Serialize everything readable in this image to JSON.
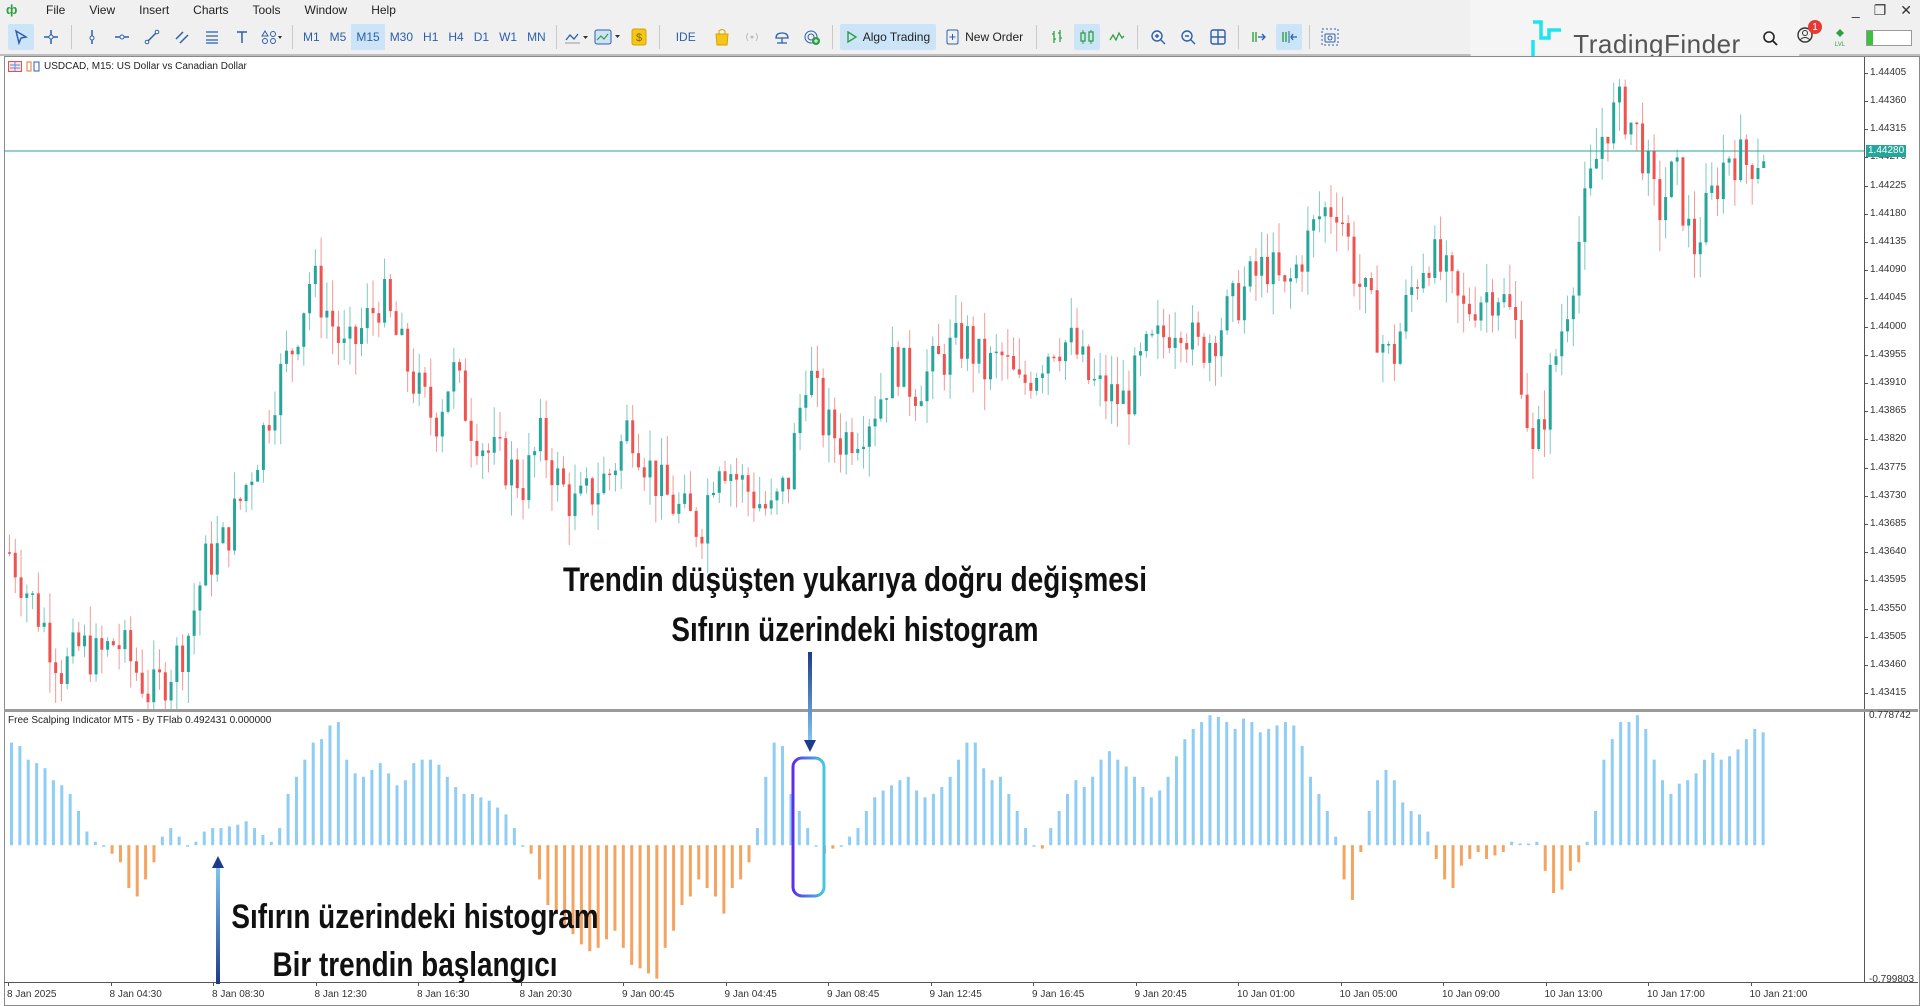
{
  "app": {
    "menu": [
      "File",
      "View",
      "Insert",
      "Charts",
      "Tools",
      "Window",
      "Help"
    ],
    "window_controls": [
      "minimize",
      "restore",
      "close"
    ]
  },
  "toolbar": {
    "draw_tools": [
      {
        "name": "cursor-icon",
        "active": true
      },
      {
        "name": "crosshair-icon",
        "active": false
      },
      {
        "name": "vertical-line-icon",
        "active": false
      },
      {
        "name": "horizontal-line-icon",
        "active": false
      },
      {
        "name": "trendline-icon",
        "active": false
      },
      {
        "name": "channel-icon",
        "active": false
      },
      {
        "name": "fibonacci-icon",
        "active": false
      },
      {
        "name": "text-icon",
        "active": false
      },
      {
        "name": "shapes-icon",
        "active": false
      }
    ],
    "timeframes": [
      "M1",
      "M5",
      "M15",
      "M30",
      "H1",
      "H4",
      "D1",
      "W1",
      "MN"
    ],
    "active_timeframe": "M15",
    "ide_label": "IDE",
    "algo_trading_label": "Algo Trading",
    "new_order_label": "New Order",
    "notification_count": "1"
  },
  "watermark": {
    "text": "TradingFinder"
  },
  "chart": {
    "title": "USDCAD, M15:  US Dollar vs Canadian Dollar",
    "last_price": "1.44280",
    "colors": {
      "bull": "#26a69a",
      "bear": "#ef5350",
      "hist_pos": "#8ecdf5",
      "hist_neg": "#f4a460",
      "price_line": "#26a69a"
    }
  },
  "indicator": {
    "title": "Free Scalping Indicator MT5 - By TFlab 0.492431 0.000000",
    "max_label": "0.778742",
    "min_label": "-0.799803"
  },
  "annotations": {
    "top_line1": "Trendin düşüşten yukarıya doğru değişmesi",
    "top_line2": "Sıfırın üzerindeki histogram",
    "bottom_line1": "Sıfırın üzerindeki histogram",
    "bottom_line2": "Bir trendin başlangıcı"
  },
  "chart_data": {
    "type": "candlestick",
    "title": "USDCAD, M15",
    "price_ticks": [
      "1.44405",
      "1.44360",
      "1.44315",
      "1.44270",
      "1.44225",
      "1.44180",
      "1.44135",
      "1.44090",
      "1.44045",
      "1.44000",
      "1.43955",
      "1.43910",
      "1.43865",
      "1.43820",
      "1.43775",
      "1.43730",
      "1.43685",
      "1.43640",
      "1.43595",
      "1.43550",
      "1.43505",
      "1.43460",
      "1.43415"
    ],
    "price_range": [
      1.4339,
      1.4443
    ],
    "time_ticks": [
      "8 Jan 2025",
      "8 Jan 04:30",
      "8 Jan 08:30",
      "8 Jan 12:30",
      "8 Jan 16:30",
      "8 Jan 20:30",
      "9 Jan 00:45",
      "9 Jan 04:45",
      "9 Jan 08:45",
      "9 Jan 12:45",
      "9 Jan 16:45",
      "9 Jan 20:45",
      "10 Jan 01:00",
      "10 Jan 05:00",
      "10 Jan 09:00",
      "10 Jan 13:00",
      "10 Jan 17:00",
      "10 Jan 21:00"
    ],
    "close_path": [
      1.4364,
      1.4358,
      1.4352,
      1.4345,
      1.4349,
      1.4347,
      1.435,
      1.4346,
      1.4341,
      1.4345,
      1.435,
      1.4362,
      1.4365,
      1.4372,
      1.438,
      1.439,
      1.4397,
      1.4408,
      1.4402,
      1.4395,
      1.44,
      1.4405,
      1.4397,
      1.439,
      1.4385,
      1.4393,
      1.4385,
      1.438,
      1.4378,
      1.4375,
      1.4382,
      1.4375,
      1.4371,
      1.4374,
      1.4377,
      1.4385,
      1.4378,
      1.4373,
      1.437,
      1.4368,
      1.438,
      1.4376,
      1.4373,
      1.437,
      1.4376,
      1.4394,
      1.4384,
      1.4382,
      1.4384,
      1.4388,
      1.4395,
      1.439,
      1.4393,
      1.4396,
      1.4398,
      1.4393,
      1.4395,
      1.439,
      1.4394,
      1.4398,
      1.4397,
      1.4391,
      1.4389,
      1.4388,
      1.4395,
      1.4398,
      1.4402,
      1.4396,
      1.4399,
      1.4403,
      1.4407,
      1.441,
      1.4405,
      1.4412,
      1.4418,
      1.442,
      1.4408,
      1.4401,
      1.4394,
      1.4405,
      1.4412,
      1.4408,
      1.4402,
      1.4405,
      1.4406,
      1.44,
      1.4378,
      1.4392,
      1.4405,
      1.442,
      1.4432,
      1.4435,
      1.443,
      1.4418,
      1.4425,
      1.4412,
      1.442,
      1.4428,
      1.4426,
      1.4428
    ],
    "histogram": [
      0.6,
      0.58,
      0.5,
      0.48,
      0.45,
      0.38,
      0.35,
      0.3,
      0.2,
      0.08,
      0.02,
      0.0,
      -0.05,
      -0.1,
      -0.25,
      -0.3,
      -0.2,
      -0.1,
      0.05,
      0.1,
      0.05,
      0.0,
      0.02,
      0.08,
      0.1,
      0.1,
      0.11,
      0.12,
      0.14,
      0.1,
      0.06,
      0.02,
      0.1,
      0.3,
      0.4,
      0.5,
      0.6,
      0.62,
      0.7,
      0.72,
      0.5,
      0.42,
      0.4,
      0.44,
      0.48,
      0.42,
      0.35,
      0.38,
      0.48,
      0.5,
      0.5,
      0.47,
      0.4,
      0.34,
      0.3,
      0.3,
      0.28,
      0.26,
      0.22,
      0.18,
      0.1,
      0.0,
      -0.05,
      -0.2,
      -0.35,
      -0.4,
      -0.48,
      -0.52,
      -0.58,
      -0.62,
      -0.6,
      -0.55,
      -0.5,
      -0.6,
      -0.7,
      -0.72,
      -0.75,
      -0.78,
      -0.6,
      -0.5,
      -0.35,
      -0.3,
      -0.2,
      -0.25,
      -0.3,
      -0.4,
      -0.25,
      -0.2,
      -0.1,
      0.1,
      0.4,
      0.6,
      0.58,
      0.3,
      0.2,
      0.1,
      0.0,
      -0.05,
      -0.02,
      0.0,
      0.05,
      0.1,
      0.2,
      0.28,
      0.32,
      0.35,
      0.38,
      0.4,
      0.32,
      0.28,
      0.3,
      0.34,
      0.4,
      0.5,
      0.6,
      0.6,
      0.45,
      0.38,
      0.4,
      0.3,
      0.2,
      0.1,
      0.0,
      -0.02,
      0.1,
      0.2,
      0.3,
      0.38,
      0.34,
      0.4,
      0.5,
      0.55,
      0.5,
      0.46,
      0.4,
      0.34,
      0.28,
      0.32,
      0.4,
      0.52,
      0.62,
      0.68,
      0.72,
      0.76,
      0.75,
      0.72,
      0.68,
      0.74,
      0.72,
      0.66,
      0.68,
      0.7,
      0.72,
      0.7,
      0.58,
      0.4,
      0.3,
      0.2,
      0.05,
      -0.2,
      -0.32,
      -0.04,
      0.2,
      0.38,
      0.44,
      0.38,
      0.25,
      0.2,
      0.18,
      0.08,
      -0.08,
      -0.2,
      -0.25,
      -0.12,
      -0.08,
      -0.04,
      -0.08,
      -0.06,
      -0.04,
      0.02,
      0.01,
      0.01,
      0.02,
      -0.15,
      -0.28,
      -0.26,
      -0.15,
      -0.1,
      0.02,
      0.2,
      0.5,
      0.62,
      0.72,
      0.72,
      0.76,
      0.68,
      0.5,
      0.38,
      0.3,
      0.36,
      0.38,
      0.42,
      0.5,
      0.54,
      0.5,
      0.52,
      0.56,
      0.62,
      0.68,
      0.66
    ],
    "indicator_range": [
      -0.799803,
      0.778742
    ]
  }
}
